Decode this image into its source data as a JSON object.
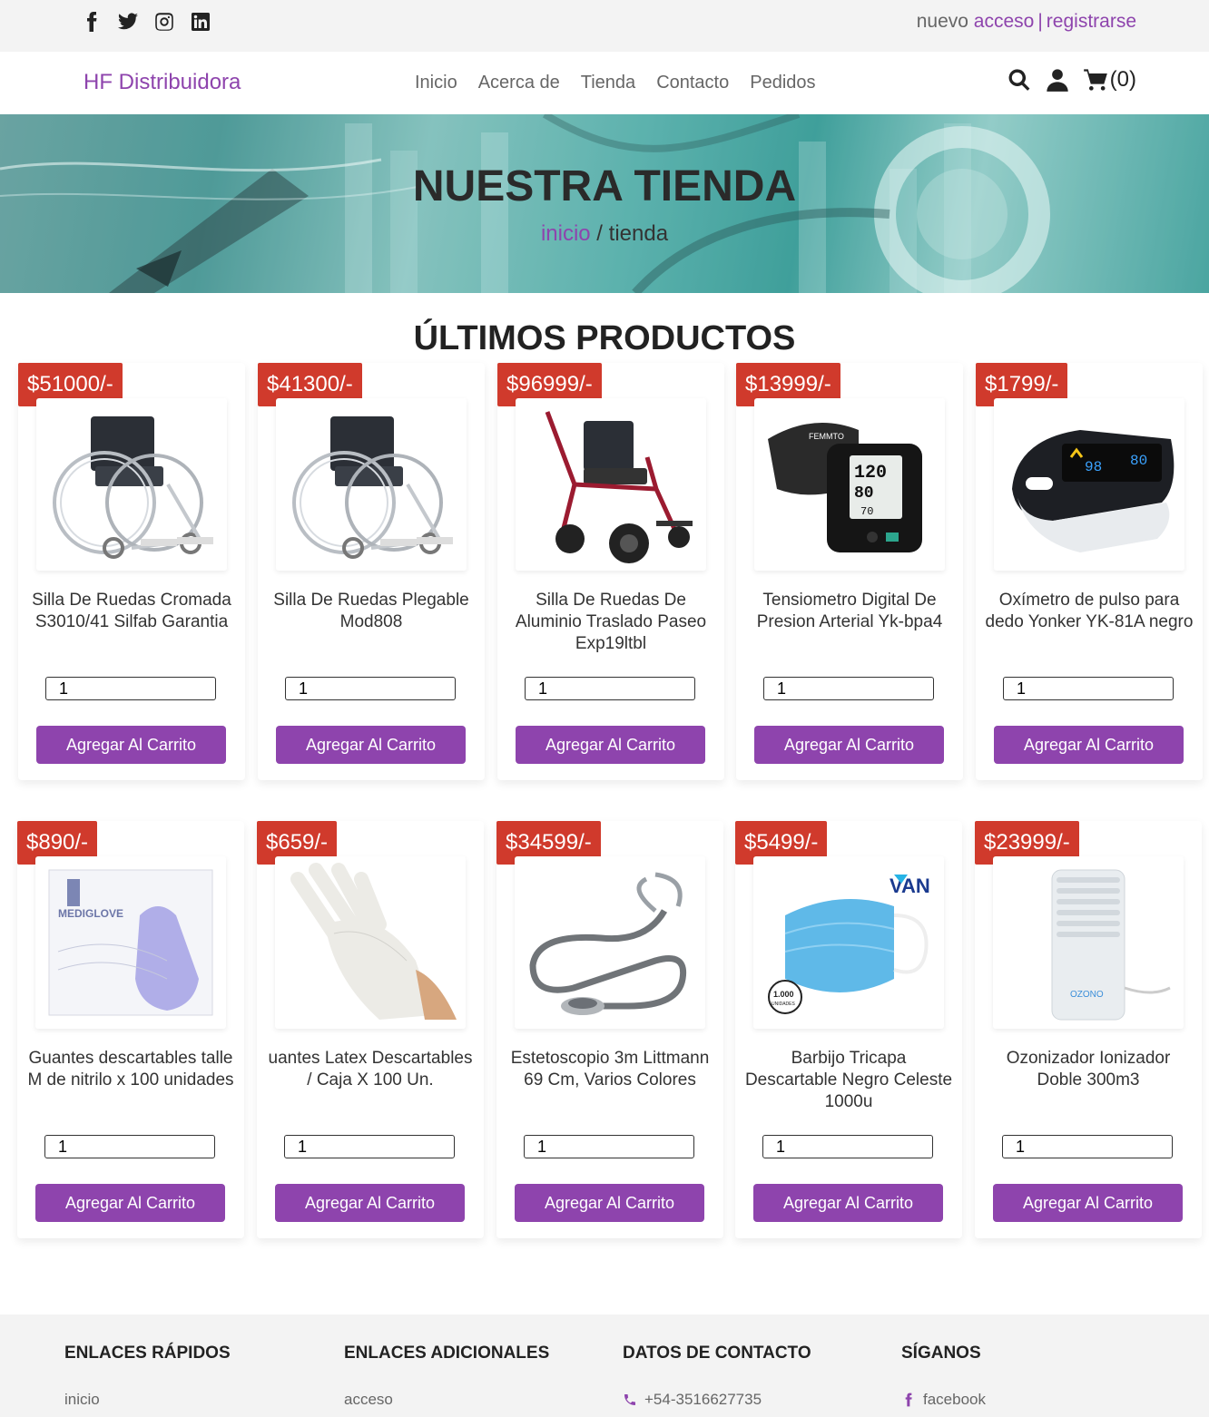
{
  "topbar": {
    "social_icons": [
      "facebook-icon",
      "twitter-icon",
      "instagram-icon",
      "linkedin-icon"
    ],
    "auth_prefix": "nuevo",
    "login_link": "acceso",
    "separator": "|",
    "register_link": "registrarse"
  },
  "header": {
    "logo": "HF Distribuidora",
    "nav": [
      "Inicio",
      "Acerca de",
      "Tienda",
      "Contacto",
      "Pedidos"
    ],
    "cart_count": "(0)"
  },
  "banner": {
    "title": "NUESTRA TIENDA",
    "crumb_home": "inicio",
    "crumb_sep": " / ",
    "crumb_current": "tienda"
  },
  "section_title": "ÚLTIMOS PRODUCTOS",
  "add_button_label": "Agregar Al Carrito",
  "products": [
    {
      "price": "$51000/-",
      "name": "Silla De Ruedas Cromada S3010/41 Silfab Garantia",
      "qty": "1",
      "image": "wheelchair-chrome"
    },
    {
      "price": "$41300/-",
      "name": "Silla De Ruedas Plegable Mod808",
      "qty": "1",
      "image": "wheelchair-chrome"
    },
    {
      "price": "$96999/-",
      "name": "Silla De Ruedas De Aluminio Traslado Paseo Exp19ltbl",
      "qty": "1",
      "image": "wheelchair-red"
    },
    {
      "price": "$13999/-",
      "name": "Tensiometro Digital De Presion Arterial Yk-bpa4",
      "qty": "1",
      "image": "blood-pressure-monitor"
    },
    {
      "price": "$1799/-",
      "name": "Oxímetro de pulso para dedo Yonker YK-81A negro",
      "qty": "1",
      "image": "pulse-oximeter"
    },
    {
      "price": "$890/-",
      "name": "Guantes descartables talle M de nitrilo x 100 unidades",
      "qty": "1",
      "image": "glove-box"
    },
    {
      "price": "$659/-",
      "name": "uantes Latex Descartables / Caja X 100 Un.",
      "qty": "1",
      "image": "latex-glove"
    },
    {
      "price": "$34599/-",
      "name": "Estetoscopio 3m Littmann 69 Cm, Varios Colores",
      "qty": "1",
      "image": "stethoscope"
    },
    {
      "price": "$5499/-",
      "name": "Barbijo Tricapa Descartable Negro Celeste 1000u",
      "qty": "1",
      "image": "face-mask"
    },
    {
      "price": "$23999/-",
      "name": "Ozonizador Ionizador Doble 300m3",
      "qty": "1",
      "image": "ozonizer"
    }
  ],
  "product_image_text": {
    "glove_box_brand": "MEDIGLOVE",
    "monitor_brand": "FEMMTO",
    "monitor_sys": "120",
    "monitor_dia": "80",
    "monitor_pulse": "70",
    "oximeter_spo2": "98",
    "oximeter_pr": "80",
    "mask_brand": "VAN",
    "mask_badge_top": "1.000",
    "mask_badge_bottom": "UNIDADES",
    "ozonizer_brand": "OZONO"
  },
  "footer": {
    "quick_links_title": "ENLACES RÁPIDOS",
    "quick_links_first": "inicio",
    "extra_links_title": "ENLACES ADICIONALES",
    "extra_links_first": "acceso",
    "contact_title": "DATOS DE CONTACTO",
    "contact_phone": "+54-3516627735",
    "follow_title": "SÍGANOS",
    "follow_first": "facebook"
  },
  "colors": {
    "accent": "#8e44ad",
    "price_badge": "#d03a2c",
    "topbar_bg": "#f3f3f3"
  }
}
